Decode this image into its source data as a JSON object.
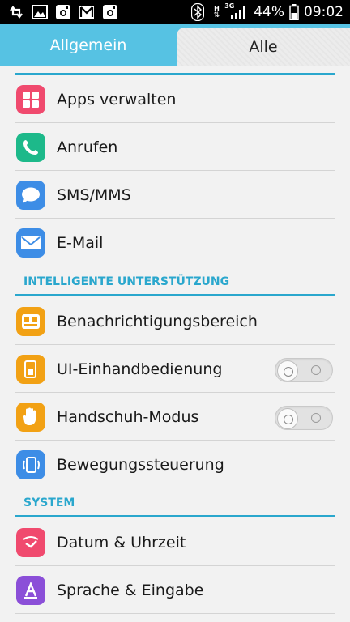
{
  "status_bar": {
    "battery_percent": "44%",
    "time": "09:02",
    "network_h": "H",
    "network_3g": "3G",
    "icons": [
      "sync-icon",
      "image-icon",
      "instagram-icon",
      "gmail-icon",
      "instagram-icon",
      "bluetooth-icon",
      "signal-icon",
      "battery-icon"
    ]
  },
  "tabs": {
    "general": "Allgemein",
    "all": "Alle"
  },
  "sections": {
    "intelligent": "INTELLIGENTE UNTERSTÜTZUNG",
    "system": "SYSTEM"
  },
  "items": [
    {
      "label": "Apps verwalten",
      "icon": "apps-icon",
      "color": "#f04a6e"
    },
    {
      "label": "Anrufen",
      "icon": "phone-icon",
      "color": "#1db98a"
    },
    {
      "label": "SMS/MMS",
      "icon": "message-icon",
      "color": "#3d8de6"
    },
    {
      "label": "E-Mail",
      "icon": "mail-icon",
      "color": "#3d8de6"
    },
    {
      "label": "Benachrichtigungsbereich",
      "icon": "notification-panel-icon",
      "color": "#f2a114"
    },
    {
      "label": "UI-Einhandbedienung",
      "icon": "one-hand-icon",
      "color": "#f2a114",
      "toggle": false
    },
    {
      "label": "Handschuh-Modus",
      "icon": "glove-icon",
      "color": "#f2a114",
      "toggle": false
    },
    {
      "label": "Bewegungssteuerung",
      "icon": "motion-icon",
      "color": "#3d8de6"
    },
    {
      "label": "Datum & Uhrzeit",
      "icon": "clock-icon",
      "color": "#f04a6e"
    },
    {
      "label": "Sprache & Eingabe",
      "icon": "language-icon",
      "color": "#8b4fd8"
    }
  ]
}
